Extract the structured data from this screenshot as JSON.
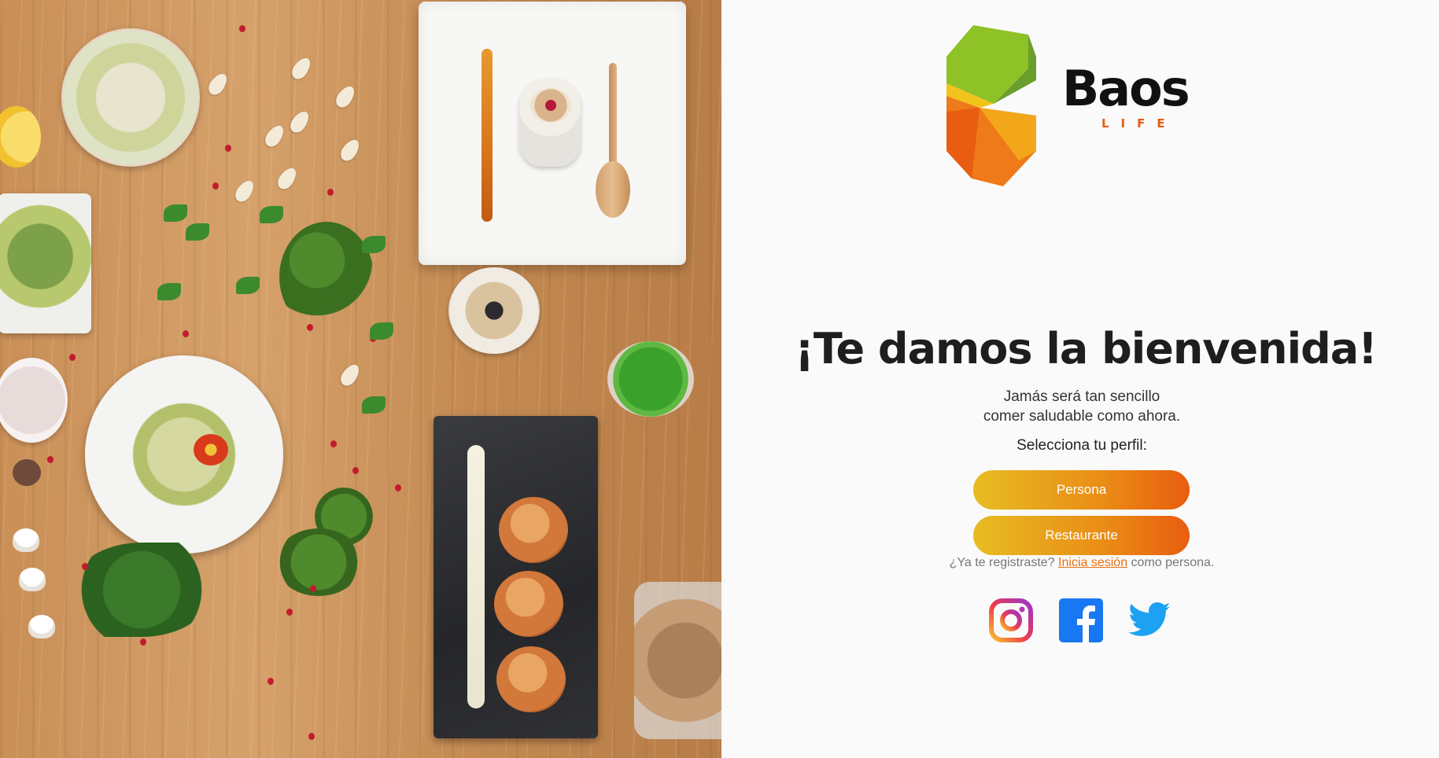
{
  "brand": {
    "name": "Baos",
    "tagline": "LIFE",
    "colors": {
      "green": "#8fc226",
      "dark_green": "#6a9e2c",
      "orange": "#ef7a19",
      "yellow_orange": "#f2a71b",
      "red_orange": "#e85d12"
    }
  },
  "hero_image": {
    "icon": "food-flatlay-photo"
  },
  "welcome": {
    "title": "¡Te damos la bienvenida!",
    "subtitle_line1": "Jamás será tan sencillo",
    "subtitle_line2": "comer saludable como ahora.",
    "profile_prompt": "Selecciona tu perfil:"
  },
  "buttons": {
    "persona": "Persona",
    "restaurante": "Restaurante",
    "gradient": [
      "#e7bd22",
      "#ea8c16",
      "#e85d0f"
    ]
  },
  "login": {
    "prefix": "¿Ya te registraste?",
    "link": "Inicia sesión",
    "suffix": "como persona."
  },
  "social": [
    {
      "icon": "instagram-icon"
    },
    {
      "icon": "facebook-icon"
    },
    {
      "icon": "twitter-icon"
    }
  ]
}
